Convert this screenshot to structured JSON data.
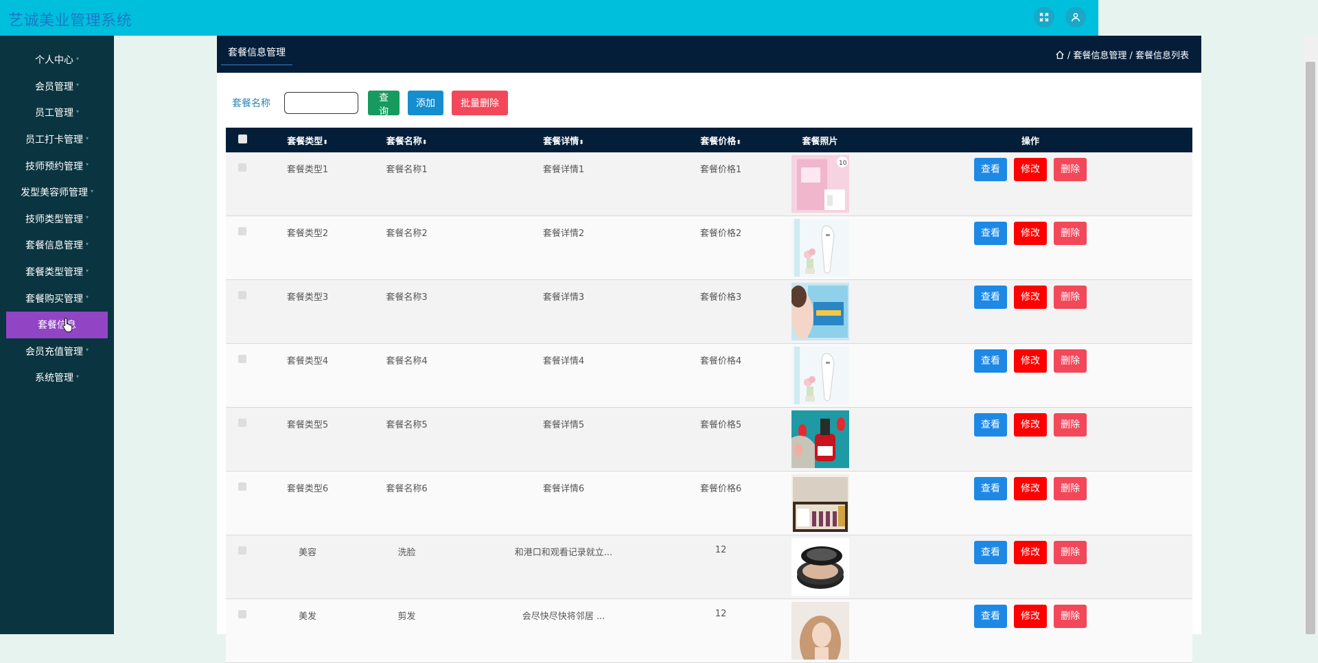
{
  "app": {
    "title": "艺诚美业管理系统"
  },
  "sidebar": {
    "items": [
      {
        "label": "个人中心"
      },
      {
        "label": "会员管理"
      },
      {
        "label": "员工管理"
      },
      {
        "label": "员工打卡管理"
      },
      {
        "label": "技师预约管理"
      },
      {
        "label": "发型美容师管理"
      },
      {
        "label": "技师类型管理"
      },
      {
        "label": "套餐信息管理"
      },
      {
        "label": "套餐类型管理"
      },
      {
        "label": "套餐购买管理"
      },
      {
        "label": "套餐信息",
        "active": true
      },
      {
        "label": "会员充值管理"
      },
      {
        "label": "系统管理"
      }
    ]
  },
  "panel": {
    "tab": "套餐信息管理",
    "breadcrumb": "/ 套餐信息管理 / 套餐信息列表"
  },
  "search": {
    "label": "套餐名称",
    "value": "",
    "query_btn": "查询",
    "add_btn": "添加",
    "batch_delete_btn": "批量删除"
  },
  "table": {
    "columns": [
      "套餐类型",
      "套餐名称",
      "套餐详情",
      "套餐价格",
      "套餐照片",
      "操作"
    ],
    "actions": {
      "view": "查看",
      "edit": "修改",
      "delete": "删除"
    },
    "rows": [
      {
        "type": "套餐类型1",
        "name": "套餐名称1",
        "detail": "套餐详情1",
        "price": "套餐价格1",
        "photo": "pink-skincare-box"
      },
      {
        "type": "套餐类型2",
        "name": "套餐名称2",
        "detail": "套餐详情2",
        "price": "套餐价格2",
        "photo": "beauty-device"
      },
      {
        "type": "套餐类型3",
        "name": "套餐名称3",
        "detail": "套餐详情3",
        "price": "套餐价格3",
        "photo": "face-mask"
      },
      {
        "type": "套餐类型4",
        "name": "套餐名称4",
        "detail": "套餐详情4",
        "price": "套餐价格4",
        "photo": "beauty-device"
      },
      {
        "type": "套餐类型5",
        "name": "套餐名称5",
        "detail": "套餐详情5",
        "price": "套餐价格5",
        "photo": "red-nail-polish"
      },
      {
        "type": "套餐类型6",
        "name": "套餐名称6",
        "detail": "套餐详情6",
        "price": "套餐价格6",
        "photo": "cosmetic-set-box"
      },
      {
        "type": "美容",
        "name": "洗脸",
        "detail": "和港口和观看记录就立...",
        "price": "12",
        "photo": "cushion-compact"
      },
      {
        "type": "美发",
        "name": "剪发",
        "detail": "会尽快尽快将邻居 ...",
        "price": "12",
        "photo": "woman-portrait"
      }
    ]
  },
  "colors": {
    "topbar": "#00bfdc",
    "sidebar": "#0a3440",
    "active_menu": "#9145c4",
    "header": "#041e3a"
  }
}
